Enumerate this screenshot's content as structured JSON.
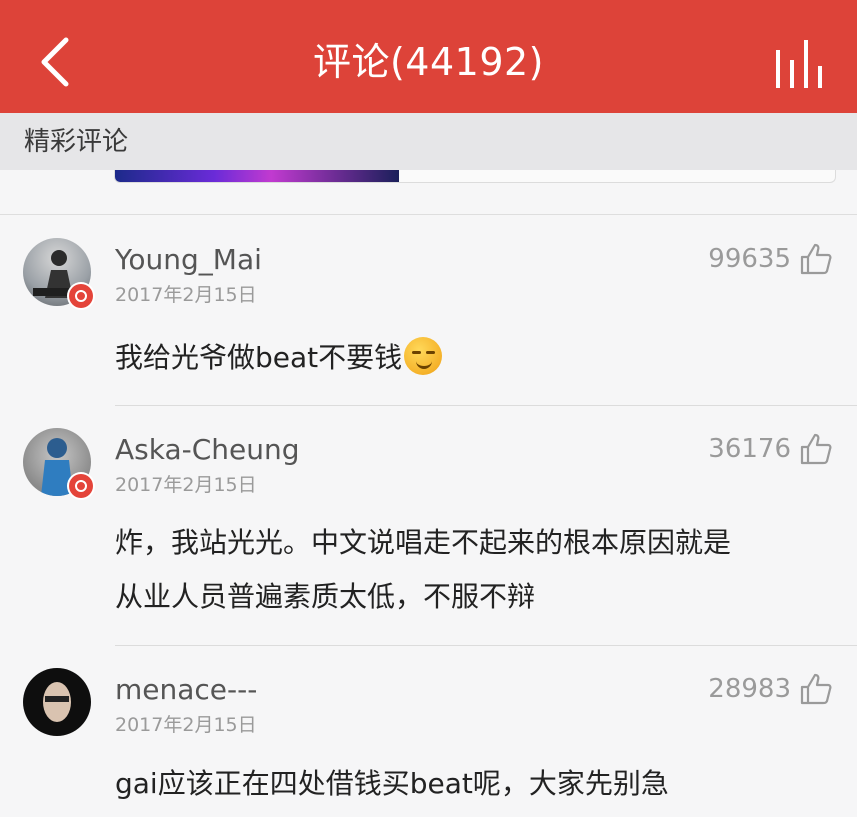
{
  "header": {
    "title": "评论(44192)"
  },
  "section": {
    "title": "精彩评论"
  },
  "comments": [
    {
      "username": "Young_Mai",
      "date": "2017年2月15日",
      "likes": "99635",
      "text": "我给光爷做beat不要钱",
      "emoji": "smirk-emoji"
    },
    {
      "username": "Aska-Cheung",
      "date": "2017年2月15日",
      "likes": "36176",
      "text_line1": "炸，我站光光。中文说唱走不起来的根本原因就是",
      "text_line2": "从业人员普遍素质太低，不服不辩"
    },
    {
      "username": "menace---",
      "date": "2017年2月15日",
      "likes": "28983",
      "text": "gai应该正在四处借钱买beat呢，大家先别急"
    }
  ],
  "colors": {
    "header": "#dd4339",
    "badge": "#e4443a",
    "section_bg": "#e6e6e8"
  }
}
